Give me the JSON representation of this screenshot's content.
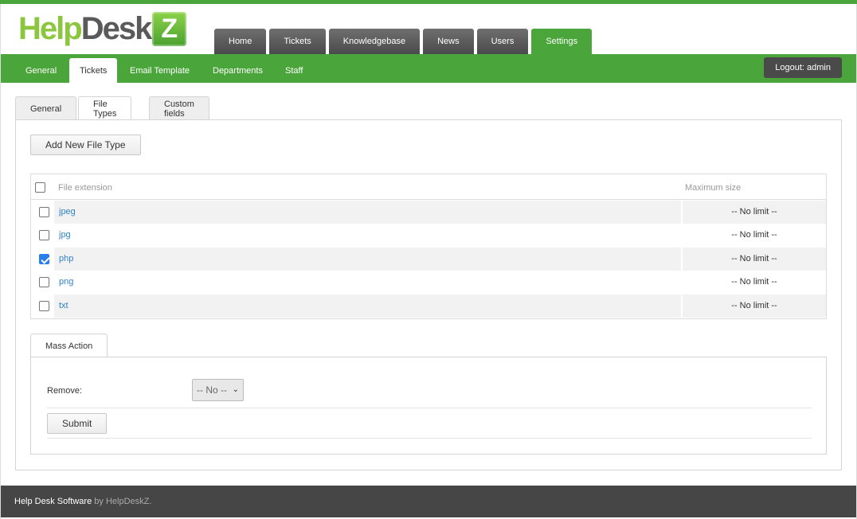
{
  "logo": {
    "part1": "Help",
    "part2": "Desk",
    "part3": "Z"
  },
  "main_nav": [
    "Home",
    "Tickets",
    "Knowledgebase",
    "News",
    "Users",
    "Settings"
  ],
  "main_nav_active": "Settings",
  "sub_nav": [
    "General",
    "Tickets",
    "Email Template",
    "Departments",
    "Staff"
  ],
  "sub_nav_active": "Tickets",
  "logout_label": "Logout: admin",
  "inner_tabs": [
    "General",
    "File Types",
    "Custom fields"
  ],
  "inner_tabs_active": "File Types",
  "add_button_label": "Add New File Type",
  "table": {
    "columns": [
      "File extension",
      "Maximum size"
    ],
    "rows": [
      {
        "ext": "jpeg",
        "max": "-- No limit --",
        "checked": false
      },
      {
        "ext": "jpg",
        "max": "-- No limit --",
        "checked": false
      },
      {
        "ext": "php",
        "max": "-- No limit --",
        "checked": true
      },
      {
        "ext": "png",
        "max": "-- No limit --",
        "checked": false
      },
      {
        "ext": "txt",
        "max": "-- No limit --",
        "checked": false
      }
    ]
  },
  "mass_action": {
    "tab_label": "Mass Action",
    "remove_label": "Remove:",
    "remove_value": "-- No --",
    "submit_label": "Submit"
  },
  "footer": {
    "link": "Help Desk Software",
    "suffix": " by HelpDeskZ."
  },
  "colors": {
    "brand_green": "#4aa53a",
    "dark_tab": "#4a4a4a",
    "link_blue": "#2f82c8"
  }
}
